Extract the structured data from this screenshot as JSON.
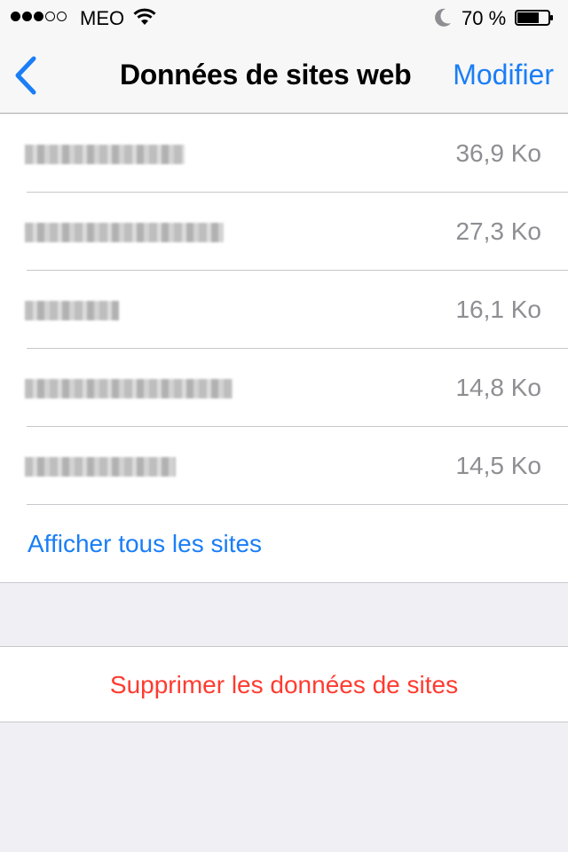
{
  "status_bar": {
    "carrier": "MEO",
    "signal_bars_filled": 3,
    "signal_bars_total": 5,
    "battery_percent": "70 %",
    "battery_level": 0.7
  },
  "nav": {
    "back_icon": "chevron-left-icon",
    "title": "Données de sites web",
    "edit_label": "Modifier"
  },
  "sites": [
    {
      "domain": "",
      "size": "36,9 Ko"
    },
    {
      "domain": "",
      "size": "27,3 Ko"
    },
    {
      "domain": "",
      "size": "16,1 Ko"
    },
    {
      "domain": "",
      "size": "14,8 Ko"
    },
    {
      "domain": "",
      "size": "14,5 Ko"
    }
  ],
  "show_all_label": "Afficher tous les sites",
  "delete_label": "Supprimer les données de sites",
  "colors": {
    "accent": "#1a7ef6",
    "destructive": "#ff3b30",
    "secondary_text": "#8e8e93"
  }
}
